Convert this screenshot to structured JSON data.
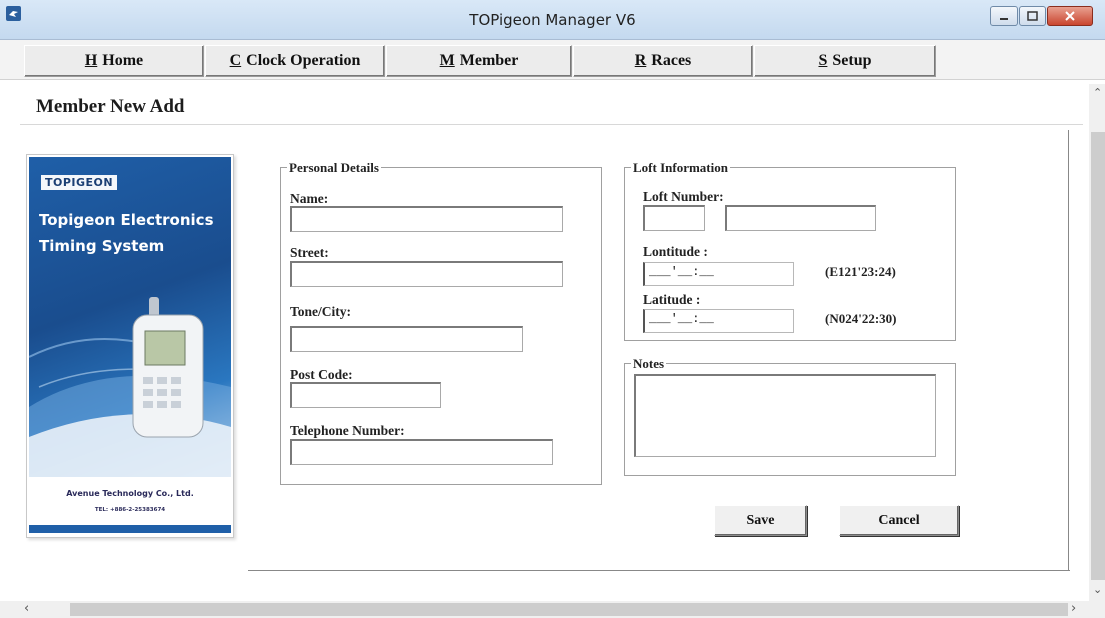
{
  "window": {
    "title": "TOPigeon Manager V6"
  },
  "menu": {
    "tabs": [
      {
        "key": "H",
        "label": "Home"
      },
      {
        "key": "C",
        "label": "Clock Operation"
      },
      {
        "key": "M",
        "label": "Member"
      },
      {
        "key": "R",
        "label": "Races"
      },
      {
        "key": "S",
        "label": "Setup"
      }
    ]
  },
  "page": {
    "title": "Member New Add"
  },
  "brochure": {
    "logo": "TOPIGEON",
    "title_line1": "Topigeon Electronics",
    "title_line2": "Timing System",
    "company": "Avenue Technology Co., Ltd.",
    "tel": "TEL: +886-2-25383674"
  },
  "personal": {
    "legend": "Personal Details",
    "name_label": "Name:",
    "name_value": "",
    "street_label": "Street:",
    "street_value": "",
    "city_label": "Tone/City:",
    "city_value": "",
    "postcode_label": "Post Code:",
    "postcode_value": "",
    "phone_label": "Telephone Number:",
    "phone_value": ""
  },
  "loft": {
    "legend": "Loft Information",
    "number_label": "Loft Number:",
    "number_prefix_value": "",
    "number_value": "",
    "longitude_label": "Lontitude :",
    "longitude_mask": "___'__:__",
    "longitude_hint": "(E121'23:24)",
    "latitude_label": "Latitude :",
    "latitude_mask": "___'__:__",
    "latitude_hint": "(N024'22:30)"
  },
  "notes": {
    "legend": "Notes",
    "value": ""
  },
  "actions": {
    "save": "Save",
    "cancel": "Cancel"
  },
  "icons": {
    "app": "pigeon-app-icon",
    "minimize": "minimize-icon",
    "maximize": "maximize-icon",
    "close": "close-icon"
  },
  "colors": {
    "brochure_blue": "#1f5fa8",
    "close_red": "#c9452f"
  }
}
